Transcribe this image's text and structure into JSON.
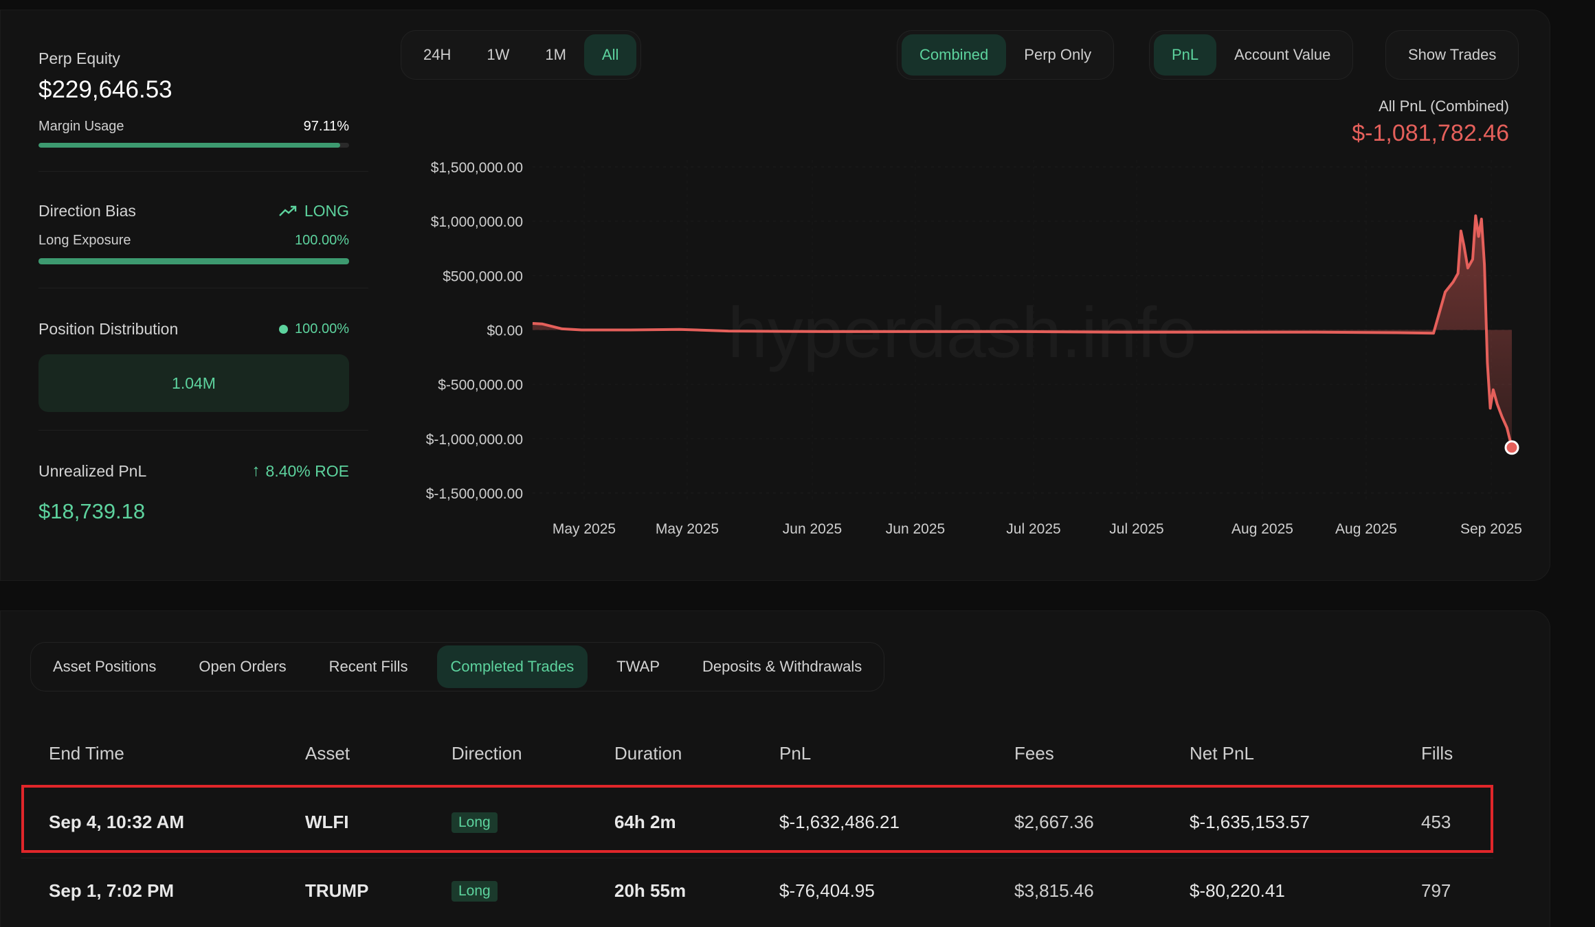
{
  "left_panel": {
    "perp_equity": {
      "label": "Perp Equity",
      "value": "$229,646.53"
    },
    "margin_usage": {
      "label": "Margin Usage",
      "value": "97.11%",
      "fraction": 0.9711
    },
    "direction_bias": {
      "label": "Direction Bias",
      "value": "LONG",
      "icon": "trend-up-icon"
    },
    "long_exposure": {
      "label": "Long Exposure",
      "value": "100.00%",
      "fraction": 1.0
    },
    "position_distribution": {
      "label": "Position Distribution",
      "value": "100.00%",
      "bar_label": "1.04M"
    },
    "unrealized_pnl": {
      "label": "Unrealized PnL",
      "roe": "8.40% ROE",
      "value": "$18,739.18",
      "icon": "arrow-up-icon"
    }
  },
  "toolbar": {
    "range_tabs": [
      "24H",
      "1W",
      "1M",
      "All"
    ],
    "range_active": "All",
    "mode_tabs": [
      "Combined",
      "Perp Only"
    ],
    "mode_active": "Combined",
    "metric_tabs": [
      "PnL",
      "Account Value"
    ],
    "metric_active": "PnL",
    "show_trades": "Show Trades"
  },
  "summary": {
    "label": "All PnL (Combined)",
    "value": "$-1,081,782.46"
  },
  "watermark": "hyperdash.info",
  "chart_data": {
    "type": "area",
    "yticks": [
      "$1,500,000.00",
      "$1,000,000.00",
      "$500,000.00",
      "$0.00",
      "$-500,000.00",
      "$-1,000,000.00",
      "$-1,500,000.00"
    ],
    "xticks": [
      "May 2025",
      "May 2025",
      "Jun 2025",
      "Jun 2025",
      "Jul 2025",
      "Jul 2025",
      "Aug 2025",
      "Aug 2025",
      "Sep 2025"
    ],
    "ylim": [
      -1500000,
      1500000
    ],
    "series": [
      {
        "color": "#e5605b",
        "points": [
          [
            0,
            60000
          ],
          [
            0.01,
            55000
          ],
          [
            0.03,
            10000
          ],
          [
            0.05,
            0
          ],
          [
            0.1,
            0
          ],
          [
            0.15,
            5000
          ],
          [
            0.2,
            -10000
          ],
          [
            0.3,
            -15000
          ],
          [
            0.4,
            -15000
          ],
          [
            0.5,
            -15000
          ],
          [
            0.6,
            -20000
          ],
          [
            0.7,
            -20000
          ],
          [
            0.8,
            -20000
          ],
          [
            0.88,
            -25000
          ],
          [
            0.92,
            -30000
          ],
          [
            0.932,
            350000
          ],
          [
            0.94,
            440000
          ],
          [
            0.945,
            520000
          ],
          [
            0.948,
            910000
          ],
          [
            0.951,
            780000
          ],
          [
            0.955,
            570000
          ],
          [
            0.96,
            650000
          ],
          [
            0.963,
            1050000
          ],
          [
            0.966,
            860000
          ],
          [
            0.969,
            1020000
          ],
          [
            0.972,
            600000
          ],
          [
            0.975,
            -300000
          ],
          [
            0.978,
            -720000
          ],
          [
            0.981,
            -550000
          ],
          [
            0.985,
            -680000
          ],
          [
            0.99,
            -800000
          ],
          [
            0.995,
            -900000
          ],
          [
            1.0,
            -1081782
          ]
        ]
      }
    ]
  },
  "bottom_tabs": [
    "Asset Positions",
    "Open Orders",
    "Recent Fills",
    "Completed Trades",
    "TWAP",
    "Deposits & Withdrawals"
  ],
  "bottom_tab_active": "Completed Trades",
  "table": {
    "headers": [
      "End Time",
      "Asset",
      "Direction",
      "Duration",
      "PnL",
      "Fees",
      "Net PnL",
      "Fills"
    ],
    "rows": [
      {
        "end_time": "Sep 4, 10:32 AM",
        "asset": "WLFI",
        "direction": "Long",
        "duration": "64h 2m",
        "pnl": "$-1,632,486.21",
        "fees": "$2,667.36",
        "net_pnl": "$-1,635,153.57",
        "fills": "453"
      },
      {
        "end_time": "Sep 1, 7:02 PM",
        "asset": "TRUMP",
        "direction": "Long",
        "duration": "20h 55m",
        "pnl": "$-76,404.95",
        "fees": "$3,815.46",
        "net_pnl": "$-80,220.41",
        "fills": "797"
      }
    ]
  }
}
